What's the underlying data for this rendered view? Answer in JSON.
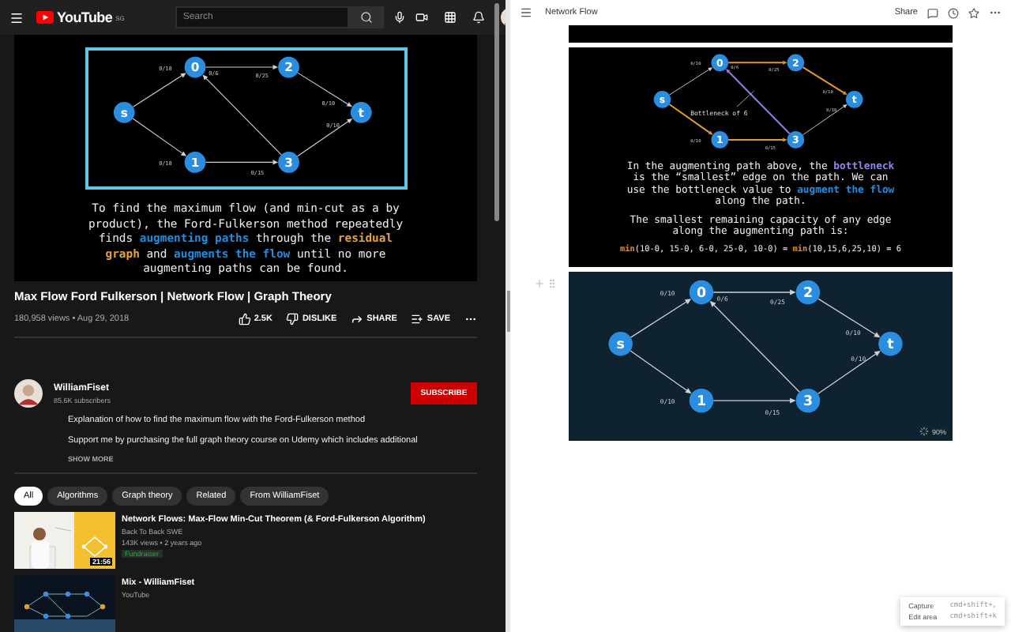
{
  "youtube": {
    "logo": "YouTube",
    "region": "SG",
    "search": {
      "placeholder": "Search"
    },
    "video": {
      "graph": {
        "nodes": [
          "s",
          "0",
          "1",
          "2",
          "3",
          "t"
        ],
        "edges": [
          {
            "label": "0/10",
            "kind": "plain"
          },
          {
            "label": "0/25",
            "kind": "plain"
          },
          {
            "label": "0/10",
            "kind": "plain"
          },
          {
            "label": "0/15",
            "kind": "plain"
          },
          {
            "label": "0/6",
            "kind": "plain"
          },
          {
            "label": "0/10",
            "kind": "plain"
          },
          {
            "label": "0/10",
            "kind": "plain"
          }
        ]
      },
      "caption": [
        [
          {
            "text": "To find the maximum flow (and min-cut as a by"
          }
        ],
        [
          {
            "text": "product), the Ford-Fulkerson method repeatedly"
          }
        ],
        [
          {
            "text": "finds "
          },
          {
            "text": "augmenting paths",
            "color": "#1a8fe8"
          },
          {
            "text": " through the "
          },
          {
            "text": "residual",
            "color": "#e9a23b"
          }
        ],
        [
          {
            "text": "graph",
            "color": "#e9a23b"
          },
          {
            "text": " and "
          },
          {
            "text": "augments the flow",
            "color": "#1a8fe8"
          },
          {
            "text": " until no more"
          }
        ],
        [
          {
            "text": "augmenting paths can be found."
          }
        ]
      ]
    },
    "title": "Max Flow Ford Fulkerson | Network Flow | Graph Theory",
    "views": "180,958 views • Aug 29, 2018",
    "actions": [
      {
        "kind": "like",
        "label": "2.5K"
      },
      {
        "kind": "dislike",
        "label": "DISLIKE"
      },
      {
        "kind": "share",
        "label": "SHARE"
      },
      {
        "kind": "save",
        "label": "SAVE"
      },
      {
        "kind": "more"
      }
    ],
    "channel": {
      "name": "WilliamFiset",
      "subscribers": "85.6K subscribers",
      "subscribe": "SUBSCRIBE"
    },
    "description": [
      "Explanation of how to find the maximum flow with the Ford-Fulkerson method",
      "Support me by purchasing the full graph theory course on Udemy which includes additional"
    ],
    "show_more": "SHOW MORE",
    "chips": [
      {
        "label": "All",
        "selected": true
      },
      {
        "label": "Algorithms",
        "selected": false
      },
      {
        "label": "Graph theory",
        "selected": false
      },
      {
        "label": "Related",
        "selected": false
      },
      {
        "label": "From WilliamFiset",
        "selected": false
      }
    ],
    "recommendations": [
      {
        "title": "Network Flows: Max-Flow Min-Cut Theorem (& Ford-Fulkerson Algorithm)",
        "channel": "Back To Back SWE",
        "meta": "143K views • 2 years ago",
        "badge": "Fundraiser",
        "duration": "21:56"
      },
      {
        "title": "Mix - WilliamFiset",
        "channel": "YouTube"
      }
    ]
  },
  "notes": {
    "title": "Network Flow",
    "share": "Share",
    "slide": {
      "graph": {
        "nodes": [
          "s",
          "0",
          "1",
          "2",
          "3",
          "t"
        ],
        "annotation": "Bottleneck of 6",
        "edges": [
          {
            "label": "0/10",
            "kind": "plain"
          },
          {
            "label": "0/25",
            "kind": "path"
          },
          {
            "label": "0/10",
            "kind": "path"
          },
          {
            "label": "0/15",
            "kind": "path"
          },
          {
            "label": "0/6",
            "kind": "bottleneck"
          },
          {
            "label": "0/10",
            "kind": "path"
          },
          {
            "label": "0/10",
            "kind": "plain"
          }
        ]
      },
      "paragraphs": [
        [
          [
            {
              "text": "In the augmenting path above, the "
            },
            {
              "text": "bottleneck",
              "color": "#8d86f0"
            }
          ],
          [
            {
              "text": "is the “smallest” edge on the path. We can"
            }
          ],
          [
            {
              "text": "use the bottleneck value to "
            },
            {
              "text": "augment the flow",
              "color": "#1a8fe8"
            }
          ],
          [
            {
              "text": "along the path."
            }
          ]
        ],
        [
          [
            {
              "text": "The smallest remaining capacity of any edge"
            }
          ],
          [
            {
              "text": "along the augmenting path is:"
            }
          ]
        ]
      ],
      "formula": [
        {
          "text": "min",
          "color": "#e0902a"
        },
        {
          "text": "(10-0, 15-0, 6-0, 25-0, 10-0) = "
        },
        {
          "text": "min",
          "color": "#e0902a"
        },
        {
          "text": "(10,15,6,25,10) = 6"
        }
      ]
    },
    "slide2": {
      "graph": {
        "nodes": [
          "s",
          "0",
          "1",
          "2",
          "3",
          "t"
        ],
        "edges": [
          {
            "label": "0/10",
            "kind": "plain"
          },
          {
            "label": "0/25",
            "kind": "plain"
          },
          {
            "label": "0/10",
            "kind": "plain"
          },
          {
            "label": "0/15",
            "kind": "plain"
          },
          {
            "label": "0/6",
            "kind": "plain"
          },
          {
            "label": "0/10",
            "kind": "plain"
          },
          {
            "label": "0/10",
            "kind": "plain"
          }
        ]
      },
      "loading": "90%"
    },
    "popup": [
      {
        "label": "Capture",
        "shortcut": "cmd+shift+,"
      },
      {
        "label": "Edit area",
        "shortcut": "cmd+shift+k"
      }
    ]
  }
}
